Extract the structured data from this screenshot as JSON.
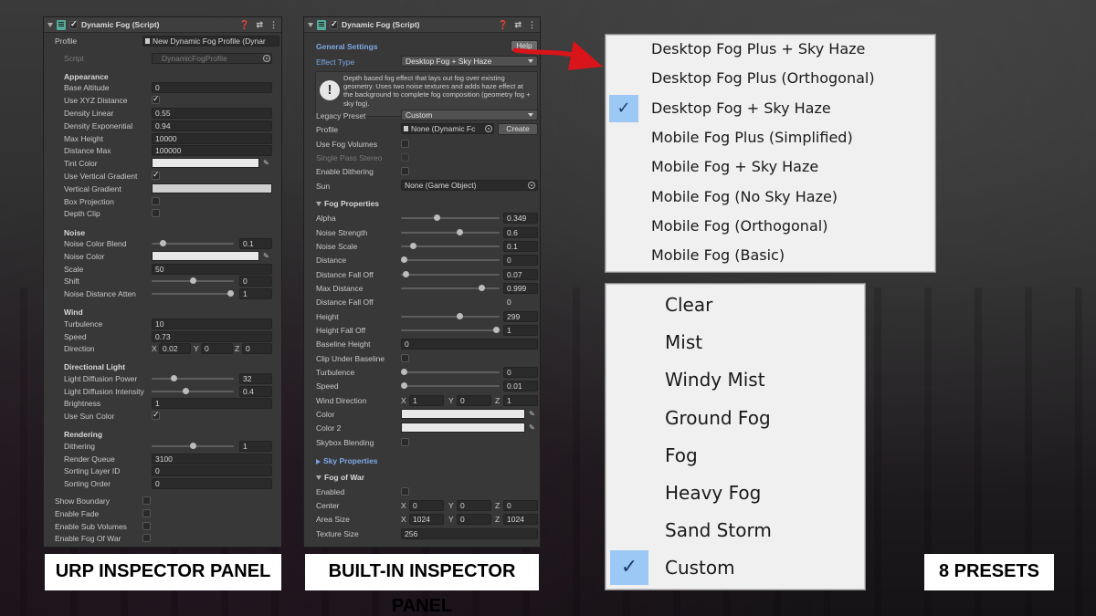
{
  "urp": {
    "title": "Dynamic Fog (Script)",
    "profile_label": "Profile",
    "profile_value": "New Dynamic Fog Profile (Dynar",
    "script_label": "Script",
    "script_value": "DynamicFogProfile",
    "sections": {
      "appearance": "Appearance",
      "noise": "Noise",
      "wind": "Wind",
      "directional_light": "Directional Light",
      "rendering": "Rendering"
    },
    "labels": {
      "base_altitude": "Base Altitude",
      "use_xyz": "Use XYZ Distance",
      "density_linear": "Density Linear",
      "density_exp": "Density Exponential",
      "max_height": "Max Height",
      "distance_max": "Distance Max",
      "tint_color": "Tint Color",
      "use_vertical_gradient": "Use Vertical Gradient",
      "vertical_gradient": "Vertical Gradient",
      "box_projection": "Box Projection",
      "depth_clip": "Depth Clip",
      "noise_color_blend": "Noise Color Blend",
      "noise_color": "Noise Color",
      "scale": "Scale",
      "shift": "Shift",
      "noise_distance_atten": "Noise Distance Atten",
      "turbulence": "Turbulence",
      "speed": "Speed",
      "direction": "Direction",
      "light_diffusion_power": "Light Diffusion Power",
      "light_diffusion_intensity": "Light Diffusion Intensity",
      "brightness": "Brightness",
      "use_sun_color": "Use Sun Color",
      "dithering": "Dithering",
      "render_queue": "Render Queue",
      "sorting_layer_id": "Sorting Layer ID",
      "sorting_order": "Sorting Order",
      "show_boundary": "Show Boundary",
      "enable_fade": "Enable Fade",
      "enable_sub_volumes": "Enable Sub Volumes",
      "enable_fog_of_war": "Enable Fog Of War"
    },
    "values": {
      "base_altitude": "0",
      "density_linear": "0.55",
      "density_exp": "0.94",
      "max_height": "10000",
      "distance_max": "100000",
      "noise_color_blend": "0.1",
      "scale": "50",
      "shift": "0",
      "noise_distance_atten": "1",
      "turbulence": "10",
      "speed": "0.73",
      "dir_x": "0.02",
      "dir_y": "0",
      "dir_z": "0",
      "light_diffusion_power": "32",
      "light_diffusion_intensity": "0.4",
      "brightness": "1",
      "dithering": "1",
      "render_queue": "3100",
      "sorting_layer_id": "0",
      "sorting_order": "0"
    },
    "axis": {
      "x": "X",
      "y": "Y",
      "z": "Z"
    }
  },
  "builtin": {
    "title": "Dynamic Fog (Script)",
    "general_settings": "General Settings",
    "help": "Help",
    "effect_type_label": "Effect Type",
    "effect_type_value": "Desktop Fog + Sky Haze",
    "info_text": "Depth based fog effect that lays out fog over existing geometry. Uses two noise textures and adds haze effect at the background to complete fog composition (geometry fog + sky fog).",
    "legacy_preset_label": "Legacy Preset",
    "legacy_preset_value": "Custom",
    "profile_label": "Profile",
    "profile_value": "None (Dynamic Fc",
    "create": "Create",
    "use_fog_volumes": "Use Fog Volumes",
    "single_pass_stereo": "Single Pass Stereo",
    "enable_dithering": "Enable Dithering",
    "sun_label": "Sun",
    "sun_value": "None (Game Object)",
    "fog_properties": "Fog Properties",
    "sky_properties": "Sky Properties",
    "fog_of_war": "Fog of War",
    "labels": {
      "alpha": "Alpha",
      "noise_strength": "Noise Strength",
      "noise_scale": "Noise Scale",
      "distance": "Distance",
      "distance_fall_off": "Distance Fall Off",
      "max_distance": "Max Distance",
      "distance_fall_off2": "Distance Fall Off",
      "height": "Height",
      "height_fall_off": "Height Fall Off",
      "baseline_height": "Baseline Height",
      "clip_under_baseline": "Clip Under Baseline",
      "turbulence": "Turbulence",
      "speed": "Speed",
      "wind_direction": "Wind Direction",
      "color": "Color",
      "color2": "Color 2",
      "skybox_blending": "Skybox Blending",
      "enabled": "Enabled",
      "center": "Center",
      "area_size": "Area Size",
      "texture_size": "Texture Size"
    },
    "values": {
      "alpha": "0.349",
      "noise_strength": "0.6",
      "noise_scale": "0.1",
      "distance": "0",
      "distance_fall_off": "0.07",
      "max_distance": "0.999",
      "distance_fall_off2": "0",
      "height": "299",
      "height_fall_off": "1",
      "baseline_height": "0",
      "turbulence": "0",
      "speed": "0.01",
      "wind_x": "1",
      "wind_y": "0",
      "wind_z": "1",
      "center_x": "0",
      "center_y": "0",
      "center_z": "0",
      "area_x": "1024",
      "area_y": "0",
      "area_z": "1024",
      "texture_size": "256"
    },
    "axis": {
      "x": "X",
      "y": "Y",
      "z": "Z"
    }
  },
  "effect_menu": {
    "items": [
      "Desktop Fog Plus + Sky Haze",
      "Desktop Fog Plus (Orthogonal)",
      "Desktop Fog + Sky Haze",
      "Mobile Fog Plus (Simplified)",
      "Mobile Fog + Sky Haze",
      "Mobile Fog (No Sky Haze)",
      "Mobile Fog (Orthogonal)",
      "Mobile Fog (Basic)"
    ],
    "selected_index": 2
  },
  "preset_menu": {
    "items": [
      "Clear",
      "Mist",
      "Windy Mist",
      "Ground Fog",
      "Fog",
      "Heavy Fog",
      "Sand Storm",
      "Custom"
    ],
    "selected_index": 7
  },
  "captions": {
    "urp": "URP INSPECTOR PANEL",
    "builtin": "BUILT-IN INSPECTOR PANEL",
    "presets": "8 PRESETS"
  },
  "colors": {
    "menu_check": "#9cc8f5",
    "arrow": "#d9141a",
    "panel_bg": "#383838"
  },
  "icons": [
    "script-icon",
    "help-icon",
    "preset-icon",
    "menu-icon",
    "eyedropper-icon",
    "info-icon",
    "object-picker-icon",
    "checkmark-icon"
  ]
}
